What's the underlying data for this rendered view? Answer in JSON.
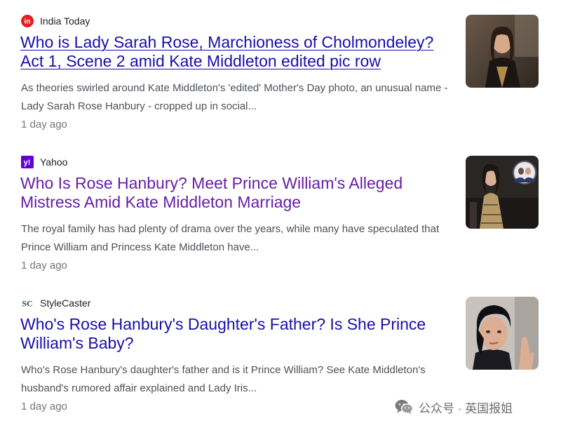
{
  "results": [
    {
      "source": "India Today",
      "title": "Who is Lady Sarah Rose, Marchioness of Cholmondeley? Act 1, Scene 2 amid Kate Middleton edited pic row",
      "snippet": "As theories swirled around Kate Middleton's 'edited' Mother's Day photo, an unusual name - Lady Sarah Rose Hanbury - cropped up in social...",
      "date": "1 day ago",
      "icon": "india-today-logo",
      "thumbnail": "woman-in-dark-jacket-photo"
    },
    {
      "source": "Yahoo",
      "title": "Who Is Rose Hanbury? Meet Prince William's Alleged Mistress Amid Kate Middleton Marriage",
      "snippet": "The royal family has had plenty of drama over the years, while many have speculated that Prince William and Princess Kate Middleton have...",
      "date": "1 day ago",
      "icon": "yahoo-logo",
      "thumbnail": "woman-in-gold-dress-photo"
    },
    {
      "source": "StyleCaster",
      "title": "Who's Rose Hanbury's Daughter's Father? Is She Prince William's Baby?",
      "snippet": "Who's Rose Hanbury's daughter's father and is it Prince William? See Kate Middleton's husband's rumored affair explained and Lady Iris...",
      "date": "1 day ago",
      "icon": "stylecaster-logo",
      "thumbnail": "woman-portrait-photo"
    }
  ],
  "watermark": {
    "text": "公众号 · 英国报姐",
    "icon": "wechat-icon"
  },
  "colors": {
    "title_link": "#1a0dab",
    "title_visited": "#681da8",
    "snippet": "#4d5156",
    "date": "#70757a",
    "india_today_red": "#e31e24",
    "yahoo_purple": "#6001d2",
    "stylecaster_green": "#1e5631"
  }
}
